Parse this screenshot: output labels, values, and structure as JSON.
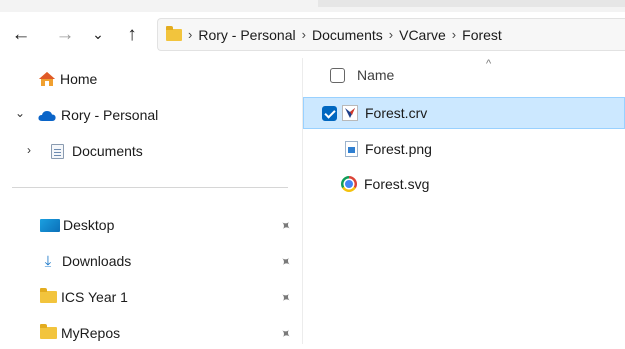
{
  "nav": {
    "back_glyph": "←",
    "forward_glyph": "→",
    "recent_glyph": "⌄",
    "up_glyph": "↑"
  },
  "address": {
    "crumbs": [
      "Rory - Personal",
      "Documents",
      "VCarve",
      "Forest"
    ],
    "separator": "›"
  },
  "sidebar": {
    "items": [
      {
        "label": "Home",
        "icon": "home-icon"
      },
      {
        "label": "Rory - Personal",
        "icon": "onedrive-cloud-icon",
        "chevron": "⌄"
      },
      {
        "label": "Documents",
        "icon": "documents-icon",
        "chevron": "›"
      }
    ],
    "quick_access": [
      {
        "label": "Desktop",
        "icon": "desktop-icon",
        "pinned": true
      },
      {
        "label": "Downloads",
        "icon": "download-icon",
        "pinned": true
      },
      {
        "label": "ICS Year 1",
        "icon": "folder-icon",
        "pinned": true
      },
      {
        "label": "MyRepos",
        "icon": "folder-icon",
        "pinned": true
      }
    ],
    "pin_glyph": "📌"
  },
  "file_list": {
    "column_name": "Name",
    "sort_glyph": "^",
    "files": [
      {
        "name": "Forest.crv",
        "icon": "vcarve-file-icon",
        "selected": true
      },
      {
        "name": "Forest.png",
        "icon": "image-file-icon",
        "selected": false
      },
      {
        "name": "Forest.svg",
        "icon": "chrome-icon",
        "selected": false
      }
    ]
  },
  "colors": {
    "selection_bg": "#cce8ff",
    "accent": "#0067c0",
    "folder": "#f2c43d"
  }
}
